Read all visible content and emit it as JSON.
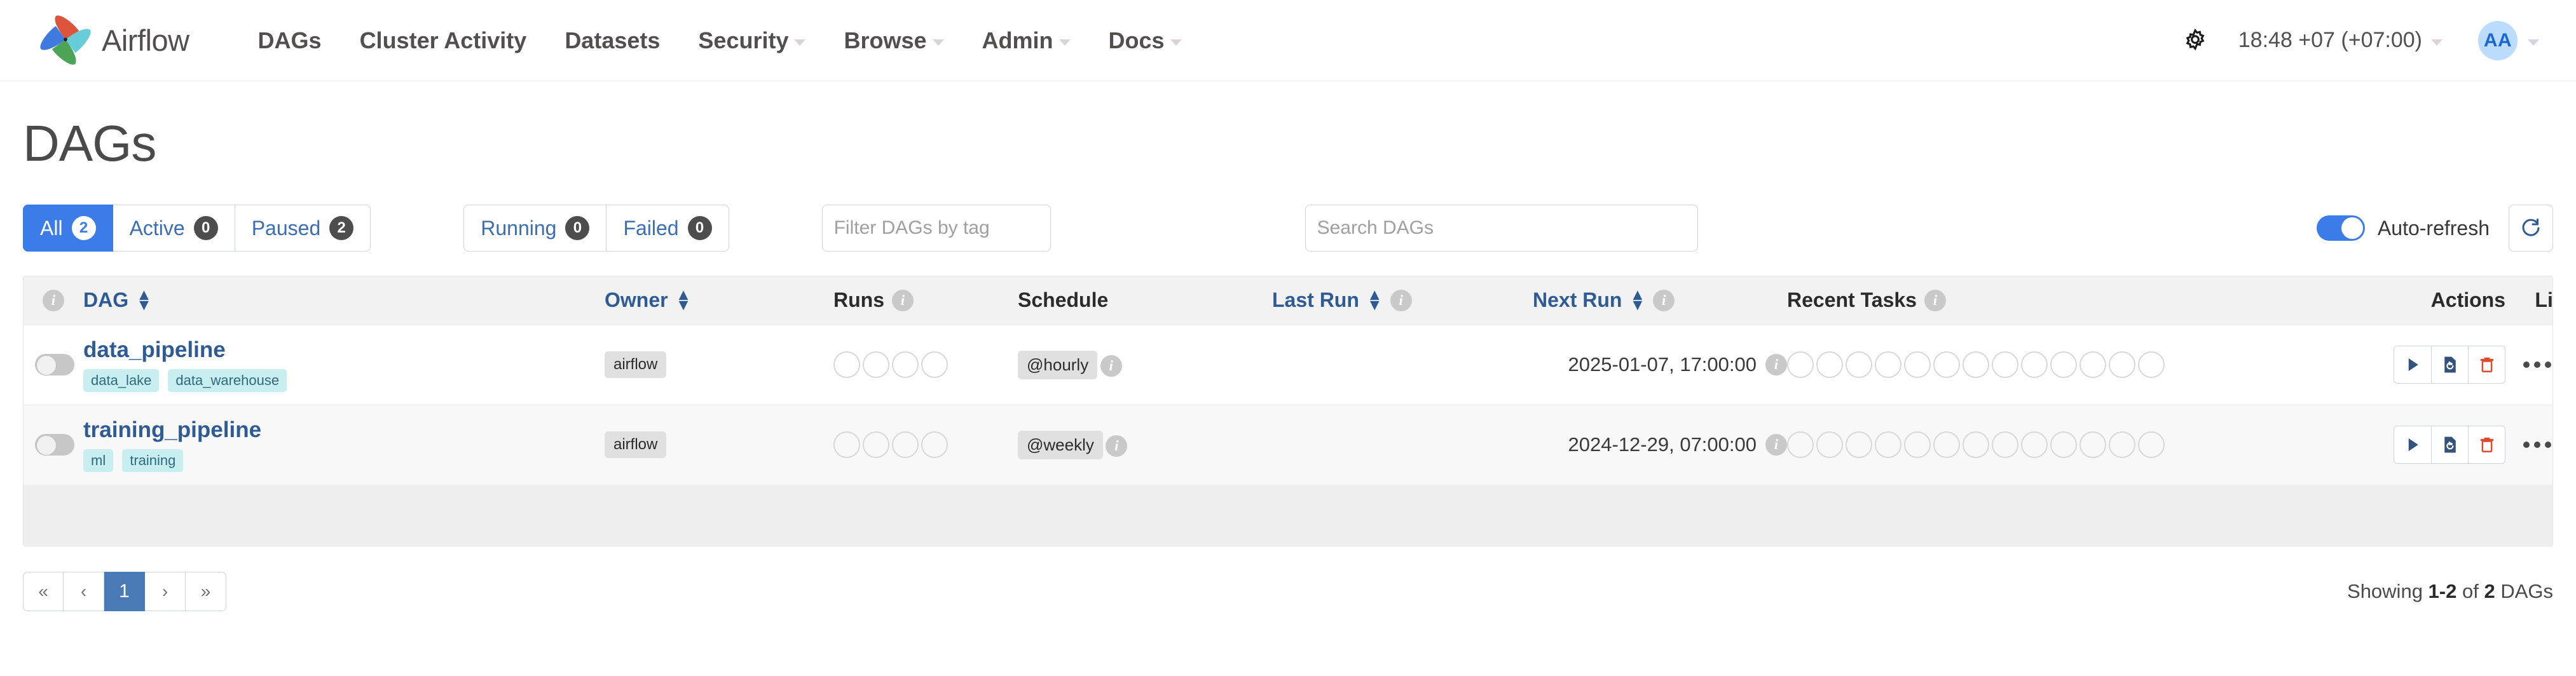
{
  "navbar": {
    "brand_label": "Airflow",
    "brand_logo_icon": "airflow-pinwheel-logo",
    "links": [
      {
        "label": "DAGs",
        "has_caret": false
      },
      {
        "label": "Cluster Activity",
        "has_caret": false
      },
      {
        "label": "Datasets",
        "has_caret": false
      },
      {
        "label": "Security",
        "has_caret": true
      },
      {
        "label": "Browse",
        "has_caret": true
      },
      {
        "label": "Admin",
        "has_caret": true
      },
      {
        "label": "Docs",
        "has_caret": true
      }
    ],
    "gear_icon": "gear-icon",
    "clock_label": "18:48 +07 (+07:00)",
    "avatar_initials": "AA"
  },
  "page": {
    "title": "DAGs"
  },
  "filters": {
    "status": [
      {
        "label": "All",
        "count": "2",
        "active": true
      },
      {
        "label": "Active",
        "count": "0",
        "active": false
      },
      {
        "label": "Paused",
        "count": "2",
        "active": false
      }
    ],
    "runstate": [
      {
        "label": "Running",
        "count": "0",
        "active": false
      },
      {
        "label": "Failed",
        "count": "0",
        "active": false
      }
    ],
    "tag_placeholder": "Filter DAGs by tag",
    "tag_value": "",
    "search_placeholder": "Search DAGs",
    "search_value": "",
    "auto_refresh_label": "Auto-refresh",
    "auto_refresh_on": true,
    "refresh_icon": "refresh-icon"
  },
  "table": {
    "columns": [
      {
        "key": "toggle",
        "label": "",
        "info": true,
        "sortable": false
      },
      {
        "key": "dag",
        "label": "DAG",
        "info": false,
        "sortable": true
      },
      {
        "key": "owner",
        "label": "Owner",
        "info": false,
        "sortable": true
      },
      {
        "key": "runs",
        "label": "Runs",
        "info": true,
        "sortable": false
      },
      {
        "key": "schedule",
        "label": "Schedule",
        "info": false,
        "sortable": false
      },
      {
        "key": "last_run",
        "label": "Last Run",
        "info": true,
        "sortable": true
      },
      {
        "key": "next_run",
        "label": "Next Run",
        "info": true,
        "sortable": true
      },
      {
        "key": "recent_tasks",
        "label": "Recent Tasks",
        "info": true,
        "sortable": false
      },
      {
        "key": "actions",
        "label": "Actions",
        "info": false,
        "sortable": false
      },
      {
        "key": "links",
        "label": "Links",
        "info": false,
        "sortable": false
      }
    ],
    "rows": [
      {
        "paused": true,
        "name": "data_pipeline",
        "tags": [
          "data_lake",
          "data_warehouse"
        ],
        "owner": "airflow",
        "runs_circles": 4,
        "schedule": "@hourly",
        "last_run": "",
        "next_run": "2025-01-07, 17:00:00",
        "recent_tasks_circles": 13
      },
      {
        "paused": true,
        "name": "training_pipeline",
        "tags": [
          "ml",
          "training"
        ],
        "owner": "airflow",
        "runs_circles": 4,
        "schedule": "@weekly",
        "last_run": "",
        "next_run": "2024-12-29, 07:00:00",
        "recent_tasks_circles": 13
      }
    ],
    "action_icons": [
      "trigger-dag-play-icon",
      "clear-rerun-icon",
      "delete-dag-trash-icon"
    ],
    "links_icon": "ellipsis-menu-icon"
  },
  "footer": {
    "pagination": [
      {
        "label": "«",
        "name": "first-page",
        "current": false
      },
      {
        "label": "‹",
        "name": "prev-page",
        "current": false
      },
      {
        "label": "1",
        "name": "page-1",
        "current": true
      },
      {
        "label": "›",
        "name": "next-page",
        "current": false
      },
      {
        "label": "»",
        "name": "last-page",
        "current": false
      }
    ],
    "showing_prefix": "Showing ",
    "showing_range": "1-2",
    "showing_mid": " of ",
    "showing_total": "2",
    "showing_suffix": " DAGs"
  },
  "colors": {
    "accent_blue": "#3c7ce8",
    "link_blue": "#2f5b94",
    "tag_bg": "#c8eef0",
    "danger_red": "#e0492b",
    "page_bg": "#ffffff"
  }
}
